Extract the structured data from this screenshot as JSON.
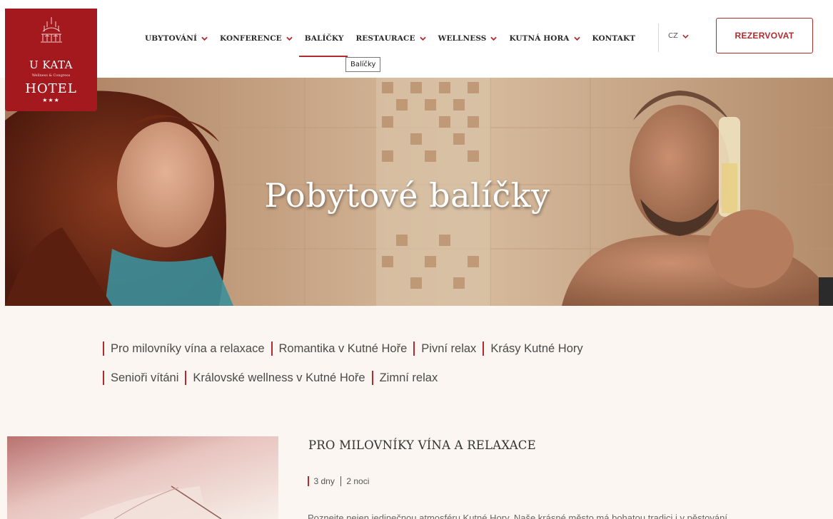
{
  "brand": {
    "name": "U KATA",
    "tagline": "Wellness & Congress",
    "hotel": "HOTEL",
    "stars": "★★★",
    "color": "#a3191e"
  },
  "nav": {
    "items": [
      {
        "label": "UBYTOVÁNÍ",
        "has_dropdown": true
      },
      {
        "label": "KONFERENCE",
        "has_dropdown": true
      },
      {
        "label": "BALÍČKY",
        "has_dropdown": false,
        "active": true
      },
      {
        "label": "RESTAURACE",
        "has_dropdown": true
      },
      {
        "label": "WELLNESS",
        "has_dropdown": true
      },
      {
        "label": "KUTNÁ HORA",
        "has_dropdown": true
      },
      {
        "label": "KONTAKT",
        "has_dropdown": false
      }
    ],
    "tooltip": "Balíčky",
    "language": "CZ",
    "reserve_label": "REZERVOVAT",
    "accent": "#b02a2e"
  },
  "hero": {
    "title": "Pobytové balíčky"
  },
  "package_links": {
    "row1": [
      "Pro milovníky vína a relaxace",
      "Romantika v Kutné Hoře",
      "Pivní relax",
      "Krásy Kutné Hory"
    ],
    "row2": [
      "Senioři vítáni",
      "Královské wellness v Kutné Hoře",
      "Zimní relax"
    ]
  },
  "package": {
    "title": "PRO MILOVNÍKY VÍNA A RELAXACE",
    "days": "3 dny",
    "nights": "2 noci",
    "description": "Poznejte nejen jedinečnou atmosféru Kutné Hory. Naše krásné město má bohatou tradici i v pěstování"
  }
}
